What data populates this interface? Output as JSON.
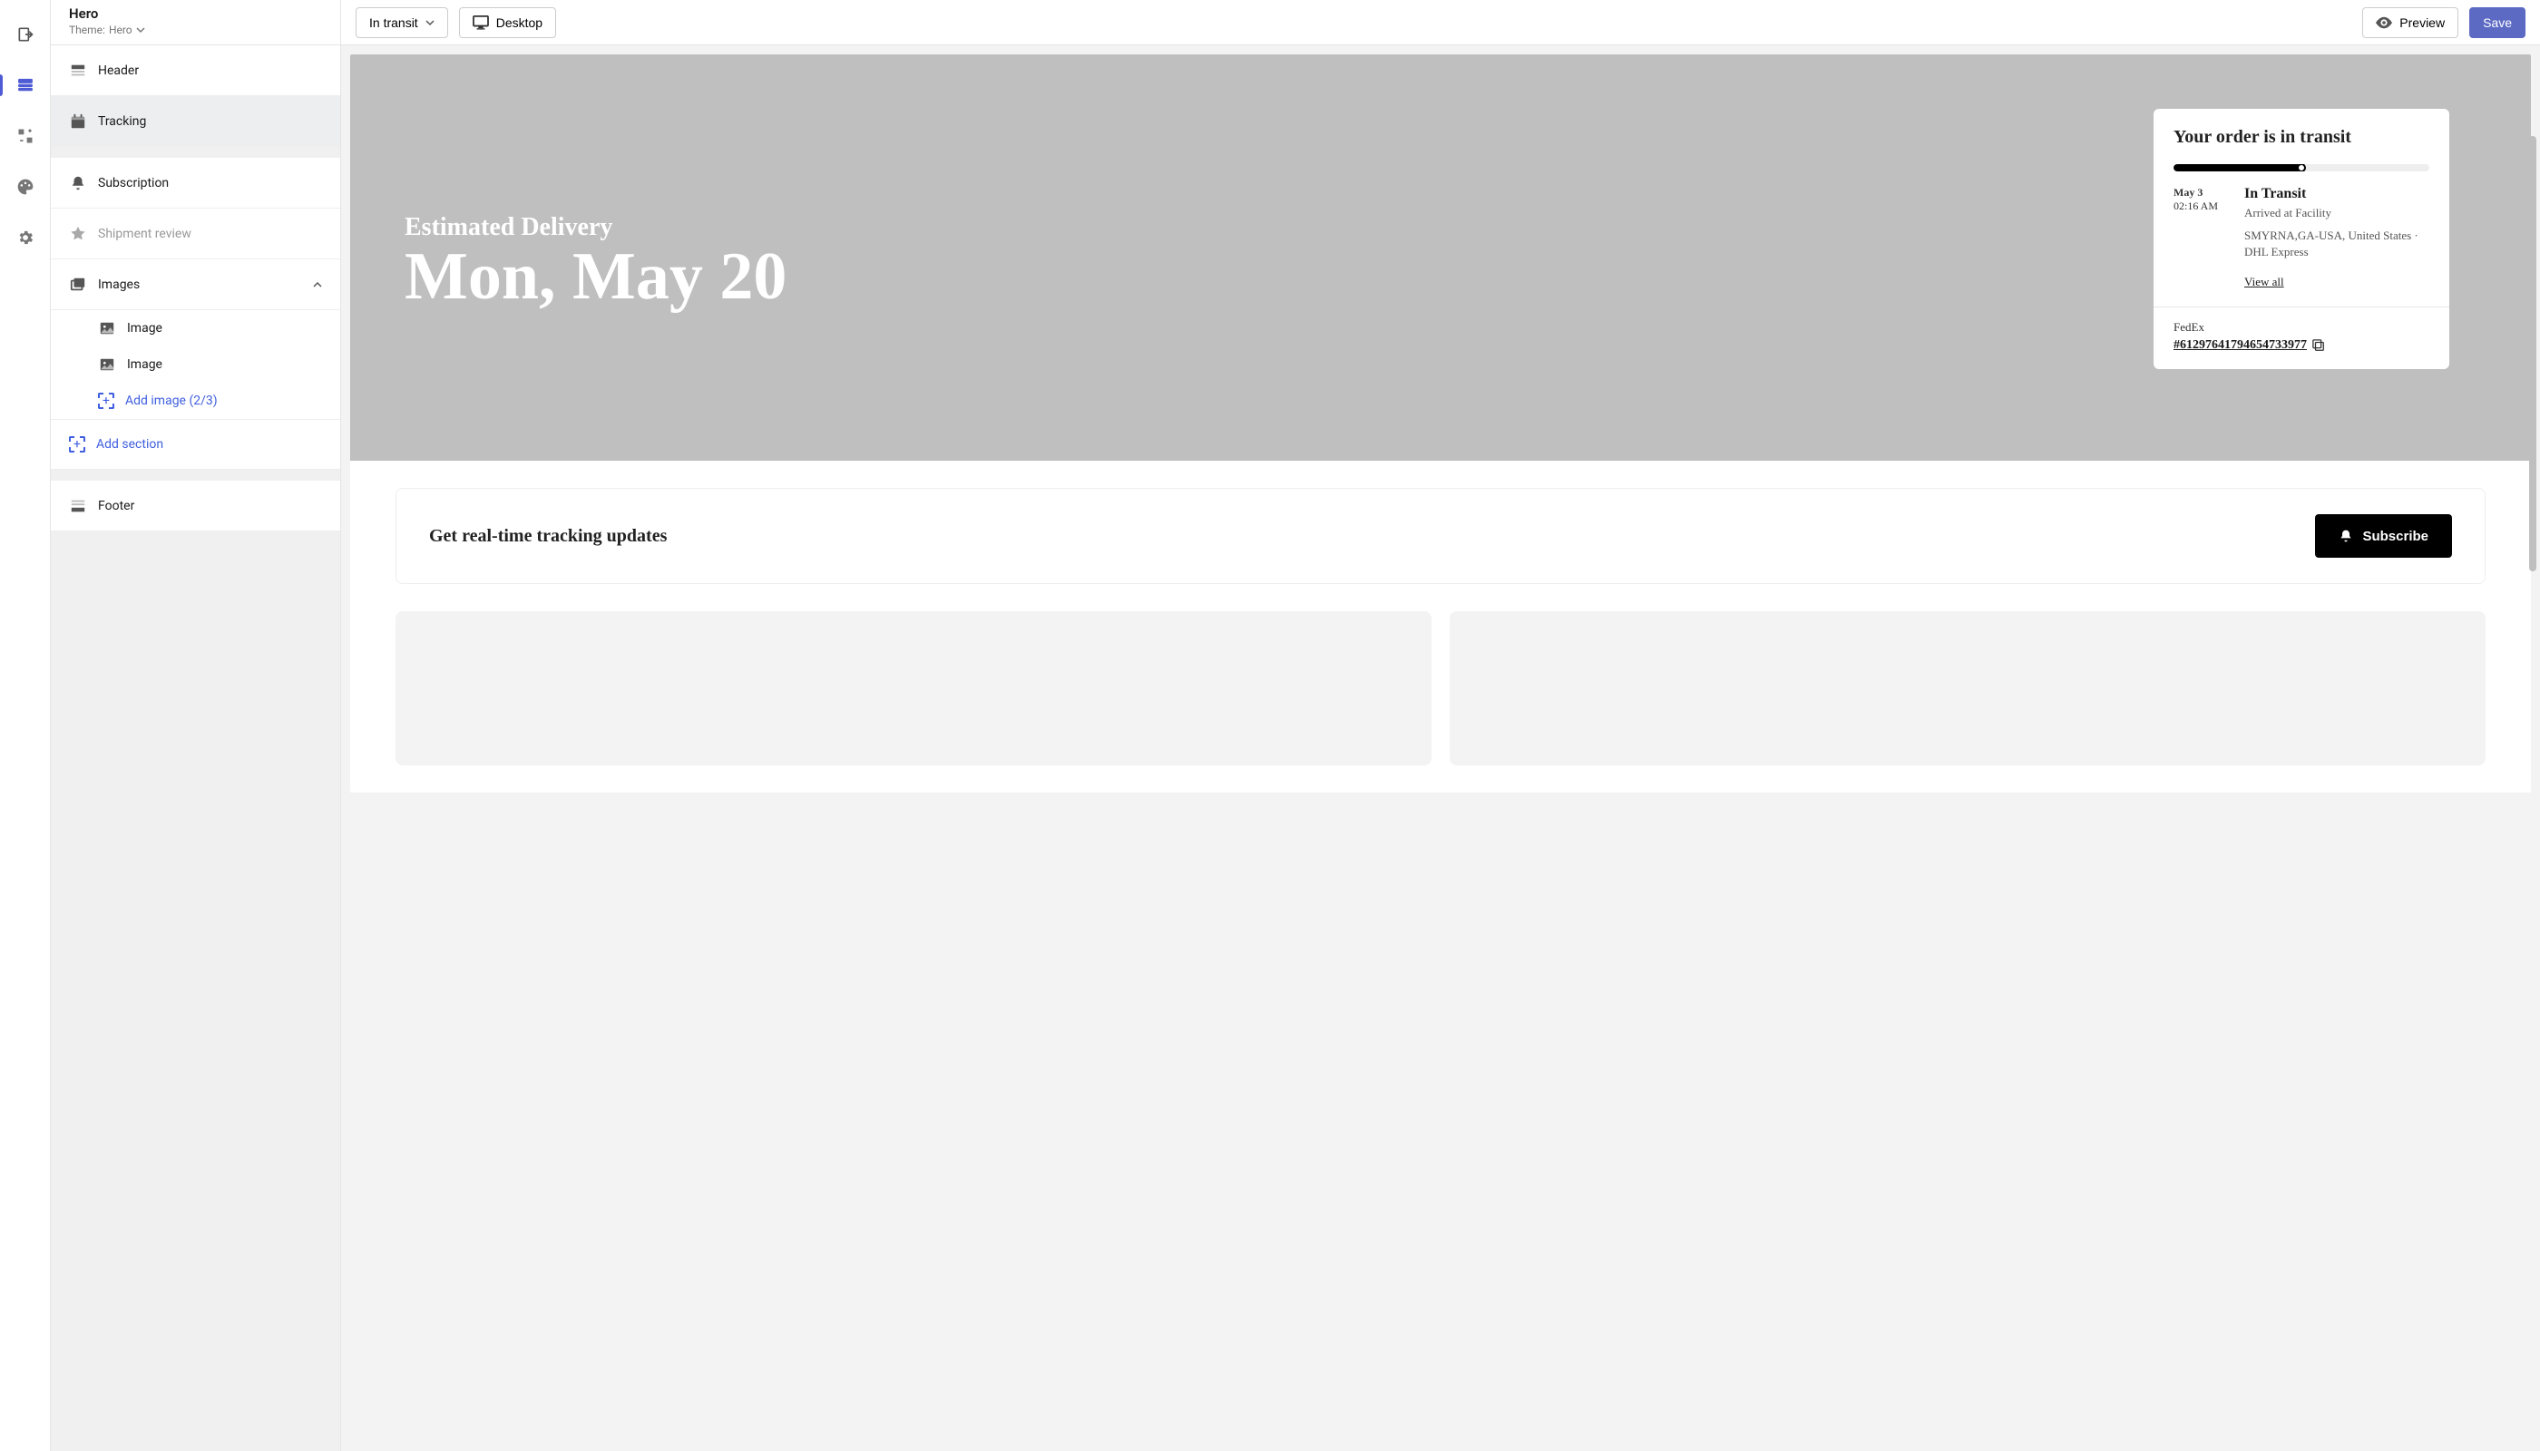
{
  "page": {
    "title": "Hero",
    "theme_prefix": "Theme:",
    "theme_name": "Hero"
  },
  "topbar": {
    "status_dropdown": "In transit",
    "device": "Desktop",
    "preview": "Preview",
    "save": "Save"
  },
  "sidebar": {
    "header": "Header",
    "tracking": "Tracking",
    "subscription": "Subscription",
    "shipment_review": "Shipment review",
    "images": "Images",
    "image_item": "Image",
    "add_image": "Add image (2/3)",
    "add_section": "Add section",
    "footer": "Footer"
  },
  "hero": {
    "label": "Estimated Delivery",
    "date": "Mon, May 20"
  },
  "track": {
    "title": "Your order is in transit",
    "date": "May 3",
    "time": "02:16 AM",
    "status": "In Transit",
    "substatus": "Arrived at Facility",
    "location": "SMYRNA,GA-USA, United States · DHL Express",
    "view_all": "View all",
    "carrier": "FedEx",
    "tracking_number": "#61297641794654733977"
  },
  "subscribe": {
    "title": "Get real-time tracking updates",
    "button": "Subscribe"
  }
}
